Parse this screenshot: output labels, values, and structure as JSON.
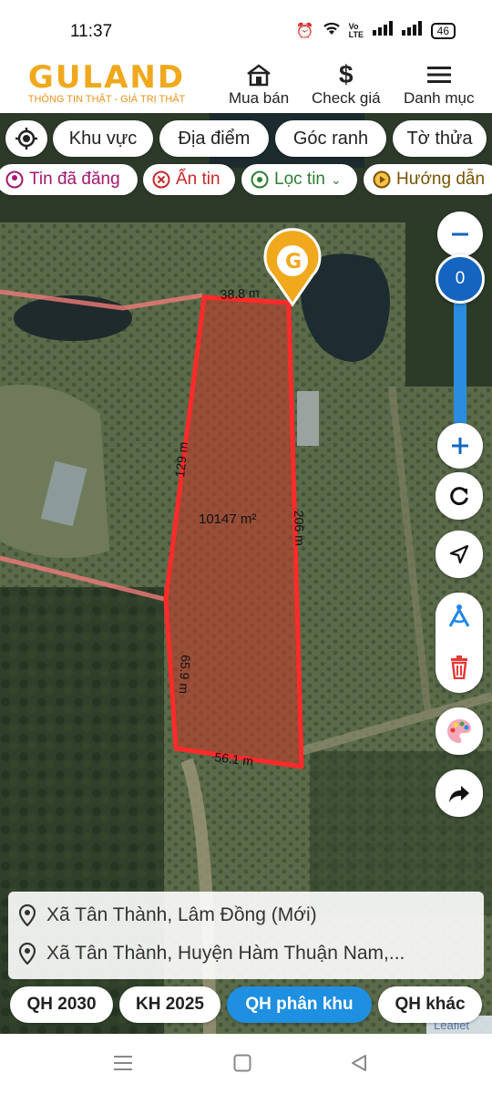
{
  "status": {
    "time": "11:37",
    "battery": "46",
    "net_label": "Vo LTE"
  },
  "brand": {
    "logo_text": "GULAND",
    "tagline": "THÔNG TIN THẬT - GIÁ TRỊ THẬT",
    "color": "#f0a81c"
  },
  "nav": [
    {
      "label": "Mua bán",
      "icon": "house-icon"
    },
    {
      "label": "Check giá",
      "icon": "dollar-icon"
    },
    {
      "label": "Danh mục",
      "icon": "menu-icon"
    }
  ],
  "filters": {
    "row1": [
      "Khu vực",
      "Địa điểm",
      "Góc ranh",
      "Tờ thửa"
    ],
    "row2": [
      {
        "label": "Tin đã đăng",
        "color": "#a3186d",
        "icon": "user-pin-icon"
      },
      {
        "label": "Ẩn tin",
        "color": "#c62828",
        "icon": "close-circle-icon"
      },
      {
        "label": "Lọc tin",
        "color": "#2e7d32",
        "icon": "pin-circle-icon"
      },
      {
        "label": "Hướng dẫn",
        "color": "#7a5200",
        "icon": "play-circle-icon"
      }
    ]
  },
  "map": {
    "zoom_value": "0",
    "area": "10147 m²",
    "edges": [
      "38.8 m",
      "129 m",
      "206 m",
      "65.9 m",
      "56.1 m"
    ],
    "parcel_color": "#ff2a2a"
  },
  "address": {
    "line1": "Xã Tân Thành, Lâm Đồng (Mới)",
    "line2": "Xã Tân Thành, Huyện Hàm Thuận Nam,..."
  },
  "plan_tabs": [
    "QH 2030",
    "KH 2025",
    "QH phân khu",
    "QH khác"
  ],
  "active_tab": "QH phân khu",
  "attribution": "Leaflet"
}
